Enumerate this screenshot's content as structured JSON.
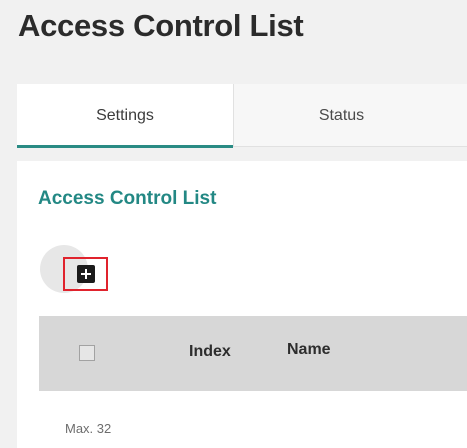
{
  "page": {
    "title": "Access Control List"
  },
  "tabs": [
    {
      "label": "Settings",
      "active": true
    },
    {
      "label": "Status",
      "active": false
    }
  ],
  "section": {
    "title": "Access Control List"
  },
  "toolbar": {
    "add_icon": "plus-square-icon",
    "add_highlight_color": "#e0232d"
  },
  "table": {
    "columns": [
      "Index",
      "Name"
    ],
    "max_note": "Max. 32"
  },
  "colors": {
    "accent": "#238884",
    "tab_indicator": "#2a8b84",
    "header_bg": "#d7d7d7"
  }
}
